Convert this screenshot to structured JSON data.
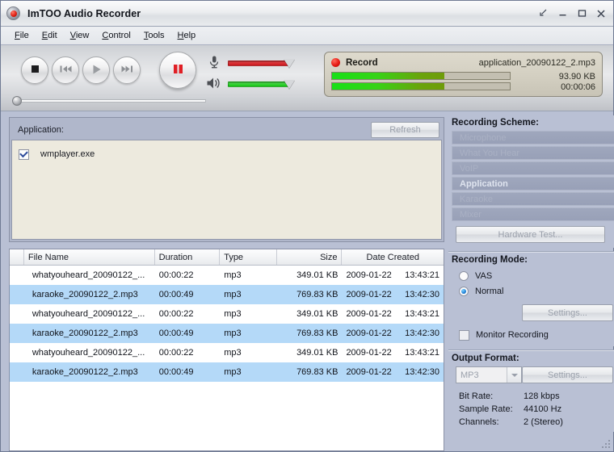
{
  "window": {
    "title": "ImTOO Audio Recorder",
    "icon": "app-record-icon",
    "buttons": [
      {
        "name": "minimize-to-tray",
        "glyph": "tray"
      },
      {
        "name": "minimize",
        "glyph": "minimize"
      },
      {
        "name": "maximize",
        "glyph": "maximize"
      },
      {
        "name": "close",
        "glyph": "close"
      }
    ]
  },
  "menu": [
    {
      "label": "File",
      "accel": "F"
    },
    {
      "label": "Edit",
      "accel": "E"
    },
    {
      "label": "View",
      "accel": "V"
    },
    {
      "label": "Control",
      "accel": "C"
    },
    {
      "label": "Tools",
      "accel": "T"
    },
    {
      "label": "Help",
      "accel": "H"
    }
  ],
  "transport": {
    "buttons": [
      {
        "name": "stop-button",
        "icon": "stop-icon"
      },
      {
        "name": "previous-button",
        "icon": "skip-back-icon"
      },
      {
        "name": "play-button",
        "icon": "play-icon"
      },
      {
        "name": "next-button",
        "icon": "skip-forward-icon"
      },
      {
        "name": "pause-button",
        "icon": "pause-icon"
      }
    ],
    "mic_slider": {
      "icon": "microphone-icon",
      "value": 100,
      "color": "#c9181f"
    },
    "speaker_slider": {
      "icon": "speaker-icon",
      "value": 100,
      "color": "#13c313"
    },
    "seek": {
      "value": 0
    }
  },
  "record_status": {
    "state_label": "Record",
    "file_name": "application_20090122_2.mp3",
    "size": "93.90 KB",
    "elapsed": "00:00:06",
    "progress_percent": 63
  },
  "application_panel": {
    "label": "Application:",
    "refresh_label": "Refresh",
    "items": [
      {
        "name": "wmplayer.exe",
        "checked": true
      }
    ]
  },
  "file_table": {
    "columns": [
      "File Name",
      "Duration",
      "Type",
      "Size",
      "Date Created"
    ],
    "rows": [
      {
        "name": "whatyouheard_20090122_...",
        "duration": "00:00:22",
        "type": "mp3",
        "size": "349.01 KB",
        "date": "2009-01-22",
        "time": "13:43:21",
        "selected": false
      },
      {
        "name": "karaoke_20090122_2.mp3",
        "duration": "00:00:49",
        "type": "mp3",
        "size": "769.83 KB",
        "date": "2009-01-22",
        "time": "13:42:30",
        "selected": true
      },
      {
        "name": "whatyouheard_20090122_...",
        "duration": "00:00:22",
        "type": "mp3",
        "size": "349.01 KB",
        "date": "2009-01-22",
        "time": "13:43:21",
        "selected": false
      },
      {
        "name": "karaoke_20090122_2.mp3",
        "duration": "00:00:49",
        "type": "mp3",
        "size": "769.83 KB",
        "date": "2009-01-22",
        "time": "13:42:30",
        "selected": true
      },
      {
        "name": "whatyouheard_20090122_...",
        "duration": "00:00:22",
        "type": "mp3",
        "size": "349.01 KB",
        "date": "2009-01-22",
        "time": "13:43:21",
        "selected": false
      },
      {
        "name": "karaoke_20090122_2.mp3",
        "duration": "00:00:49",
        "type": "mp3",
        "size": "769.83 KB",
        "date": "2009-01-22",
        "time": "13:42:30",
        "selected": true
      }
    ]
  },
  "recording_scheme": {
    "title": "Recording Scheme:",
    "items": [
      {
        "label": "Microphone",
        "selected": false
      },
      {
        "label": "What You Hear",
        "selected": false
      },
      {
        "label": "VoIP",
        "selected": false
      },
      {
        "label": "Application",
        "selected": true
      },
      {
        "label": "Karaoke",
        "selected": false
      },
      {
        "label": "Mixer",
        "selected": false
      }
    ],
    "hardware_test_label": "Hardware Test..."
  },
  "recording_mode": {
    "title": "Recording Mode:",
    "options": [
      {
        "label": "VAS",
        "selected": false
      },
      {
        "label": "Normal",
        "selected": true
      }
    ],
    "settings_label": "Settings...",
    "monitor_label": "Monitor Recording",
    "monitor_checked": false
  },
  "output_format": {
    "title": "Output Format:",
    "format": "MP3",
    "settings_label": "Settings...",
    "specs": [
      {
        "key": "Bit Rate:",
        "value": "128 kbps"
      },
      {
        "key": "Sample Rate:",
        "value": "44100 Hz"
      },
      {
        "key": "Channels:",
        "value": "2 (Stereo)"
      }
    ]
  }
}
